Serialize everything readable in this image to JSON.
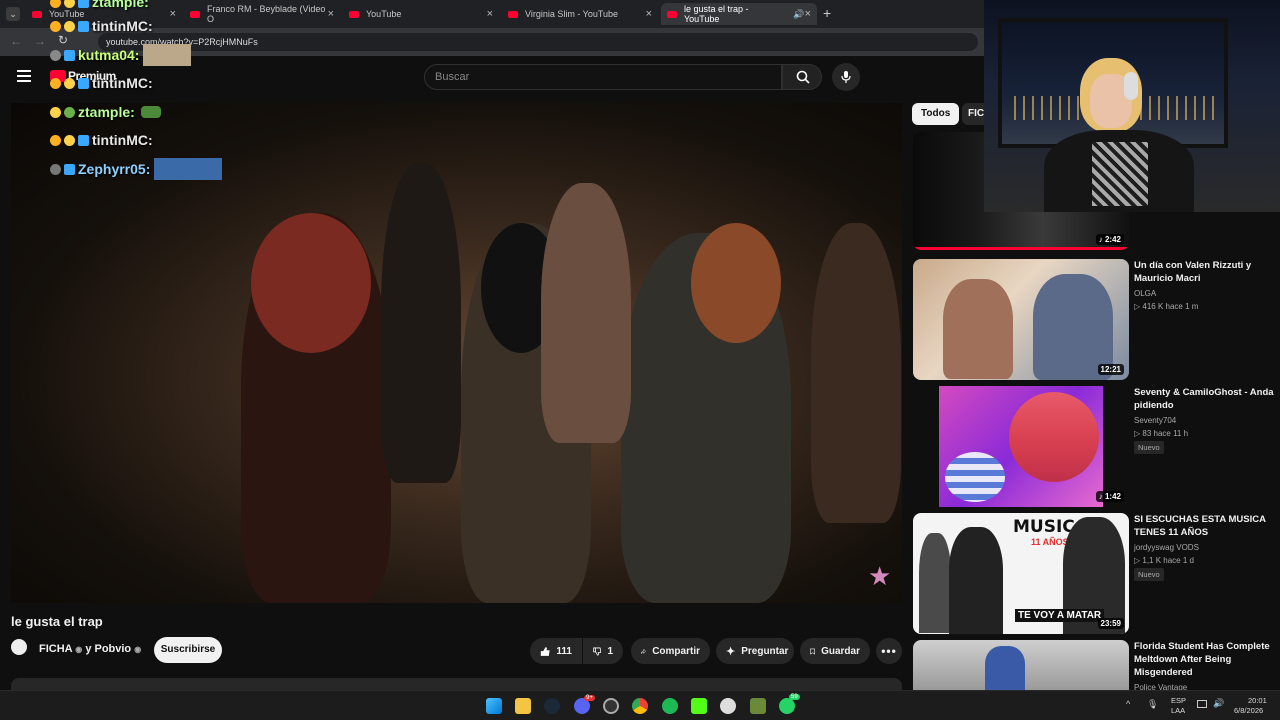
{
  "browser": {
    "tabs": [
      {
        "label": "YouTube"
      },
      {
        "label": "Franco RM - Beyblade (Video O"
      },
      {
        "label": "YouTube"
      },
      {
        "label": "Virginia Slim - YouTube"
      },
      {
        "label": "le gusta el trap - YouTube"
      }
    ],
    "url": "youtube.com/watch?v=P2RcjHMNuFs"
  },
  "youtube": {
    "premium_label": "Premium",
    "search_placeholder": "Buscar",
    "video_title": "le gusta el trap",
    "channel_name": "FICHA",
    "channel_conj": "y Pobvio",
    "subscribe_label": "Suscribirse",
    "likes": "111",
    "dislikes": "1",
    "share_label": "Compartir",
    "ask_label": "Preguntar",
    "save_label": "Guardar",
    "chips": {
      "all": "Todos",
      "ficha": "FICH"
    }
  },
  "chat": [
    {
      "user": "ztample:"
    },
    {
      "user": "tintinMC:"
    },
    {
      "user": "kutma04:"
    },
    {
      "user": "tintinMC:"
    },
    {
      "user": "ztample:"
    },
    {
      "user": "tintinMC:"
    },
    {
      "user": "Zephyrr05:"
    }
  ],
  "recommendations": [
    {
      "title": "",
      "channel": "",
      "meta": "",
      "duration": "2:42"
    },
    {
      "title": "Un día con Valen Rizzuti y Mauricio Macri",
      "channel": "OLGA",
      "meta": "▷ 416 K  hace 1 m",
      "duration": "12:21"
    },
    {
      "title": "Seventy & CamiloGhost - Anda pidiendo",
      "channel": "Seventy704",
      "meta": "▷ 83  hace 11 h",
      "badge": "Nuevo",
      "duration": "1:42"
    },
    {
      "title": "SI ESCUCHAS ESTA MUSICA TENES 11 AÑOS",
      "channel": "jordyyswag VODS",
      "meta": "▷ 1,1 K  hace 1 d",
      "badge": "Nuevo",
      "duration": "23:59",
      "thumb_text_1": "MUSICA",
      "thumb_text_2": "11 AÑOS",
      "thumb_text_3": "TE VOY A MATAR"
    },
    {
      "title": "Florida Student Has Complete Meltdown After Being Misgendered",
      "channel": "Police Vantage",
      "meta": "",
      "duration": ""
    }
  ],
  "taskbar": {
    "lang1": "ESP",
    "lang2": "LAA",
    "time": "20:01",
    "date": "6/8/2026",
    "discord_badge": "9+",
    "whatsapp_badge": "59"
  },
  "colors": {
    "youtube_red": "#ff0033",
    "bg": "#0f0f0f",
    "chip": "#272727"
  }
}
